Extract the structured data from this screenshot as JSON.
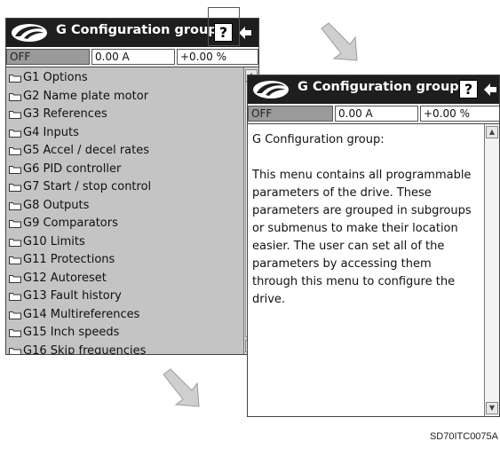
{
  "left_panel": {
    "title": "G Configuration group",
    "help_label": "?",
    "back_symbol": "🡐",
    "status": {
      "state": "OFF",
      "current": "0.00 A",
      "percent": "+0.00 %"
    },
    "items": [
      "G1 Options",
      "G2 Name plate motor",
      "G3 References",
      "G4 Inputs",
      "G5 Accel / decel rates",
      "G6 PID controller",
      "G7 Start / stop control",
      "G8 Outputs",
      "G9 Comparators",
      "G10 Limits",
      "G11 Protections",
      "G12 Autoreset",
      "G13 Fault history",
      "G14 Multireferences",
      "G15 Inch speeds",
      "G16 Skip frequencies"
    ],
    "item_icon": "folder-icon"
  },
  "right_panel": {
    "title": "G Configuration group",
    "help_label": "?",
    "back_symbol": "🡐",
    "status": {
      "state": "OFF",
      "current": "0.00 A",
      "percent": "+0.00 %"
    },
    "help_heading": "G Configuration group:",
    "help_text": "This menu contains all programmable parameters of the drive. These parameters are grouped in subgroups or submenus to make their location easier. The user can set all of the parameters by accessing them through this menu to configure the drive."
  },
  "caption": "SD70ITC0075A",
  "colors": {
    "titlebar": "#1e1e1e",
    "list_background": "#c4c4c4",
    "state_cell": "#9a9a9a",
    "arrow": "#cfcfcf"
  }
}
